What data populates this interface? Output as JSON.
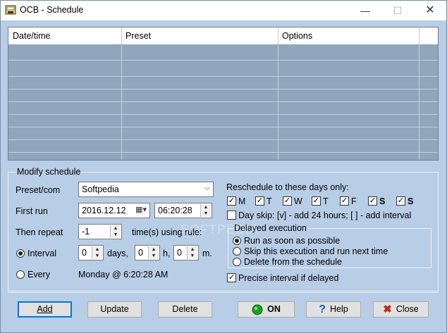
{
  "window": {
    "title": "OCB - Schedule"
  },
  "table": {
    "headers": [
      "Date/time",
      "Preset",
      "Options"
    ],
    "rows": []
  },
  "modify": {
    "group_label": "Modify schedule",
    "preset_label": "Preset/com",
    "preset_value": "Softpedia",
    "first_run_label": "First run",
    "first_run_date": "2016.12.12",
    "first_run_time": "06:20:28",
    "then_repeat_label": "Then repeat",
    "repeat_value": "-1",
    "repeat_unit_label": "time(s) using rule:",
    "interval_label": "Interval",
    "interval_days": "0",
    "days_label": "days,",
    "interval_hours": "0",
    "hours_label": "h,",
    "interval_minutes": "0",
    "minutes_label": "m.",
    "every_label": "Every",
    "every_value": "Monday @ 6:20:28 AM"
  },
  "reschedule": {
    "label": "Reschedule to these days only:",
    "days": [
      "M",
      "T",
      "W",
      "T",
      "F",
      "S",
      "S"
    ],
    "day_skip_label": "Day skip: [v] - add 24 hours; [ ] - add interval"
  },
  "delayed": {
    "label": "Delayed execution",
    "options": [
      "Run as soon as possible",
      "Skip this execution and run next time",
      "Delete from the schedule"
    ],
    "precise_label": "Precise interval if delayed"
  },
  "buttons": {
    "add": "Add",
    "update": "Update",
    "delete": "Delete",
    "on": "ON",
    "help": "Help",
    "close": "Close"
  },
  "watermark": "SOFTPEDIA",
  "colors": {
    "background": "#b8cde6",
    "grid_rows": "#8fa6bd",
    "on_green": "#1aa320",
    "close_red": "#c0261d"
  }
}
